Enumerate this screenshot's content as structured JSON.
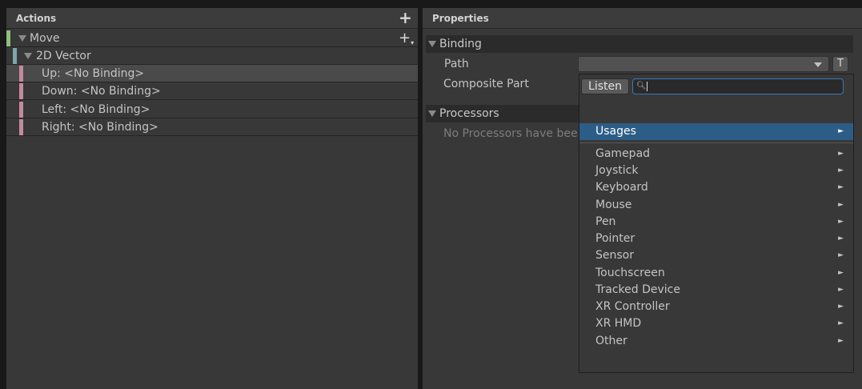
{
  "actions_panel": {
    "title": "Actions",
    "add_action_icon": "plus-icon",
    "add_binding_icon": "plus-dropdown-icon",
    "rows": [
      {
        "label": "Move",
        "color": "#8fbf7f"
      },
      {
        "label": "2D Vector",
        "color": "#7fa5aa"
      },
      {
        "label": "Up: <No Binding>",
        "color": "#c48a9c",
        "selected": true
      },
      {
        "label": "Down: <No Binding>",
        "color": "#c48a9c"
      },
      {
        "label": "Left: <No Binding>",
        "color": "#c48a9c"
      },
      {
        "label": "Right: <No Binding>",
        "color": "#c48a9c"
      }
    ]
  },
  "properties_panel": {
    "title": "Properties",
    "binding_section": {
      "title": "Binding",
      "path_label": "Path",
      "path_value": "",
      "t_button": "T",
      "composite_part_label": "Composite Part"
    },
    "processors_section": {
      "title": "Processors",
      "empty_text": "No Processors have bee"
    }
  },
  "dropdown": {
    "listen_label": "Listen",
    "search_value": "",
    "search_icon": "search-icon",
    "selected_item": "Usages",
    "items": [
      "Gamepad",
      "Joystick",
      "Keyboard",
      "Mouse",
      "Pen",
      "Pointer",
      "Sensor",
      "Touchscreen",
      "Tracked Device",
      "XR Controller",
      "XR HMD",
      "Other"
    ]
  }
}
